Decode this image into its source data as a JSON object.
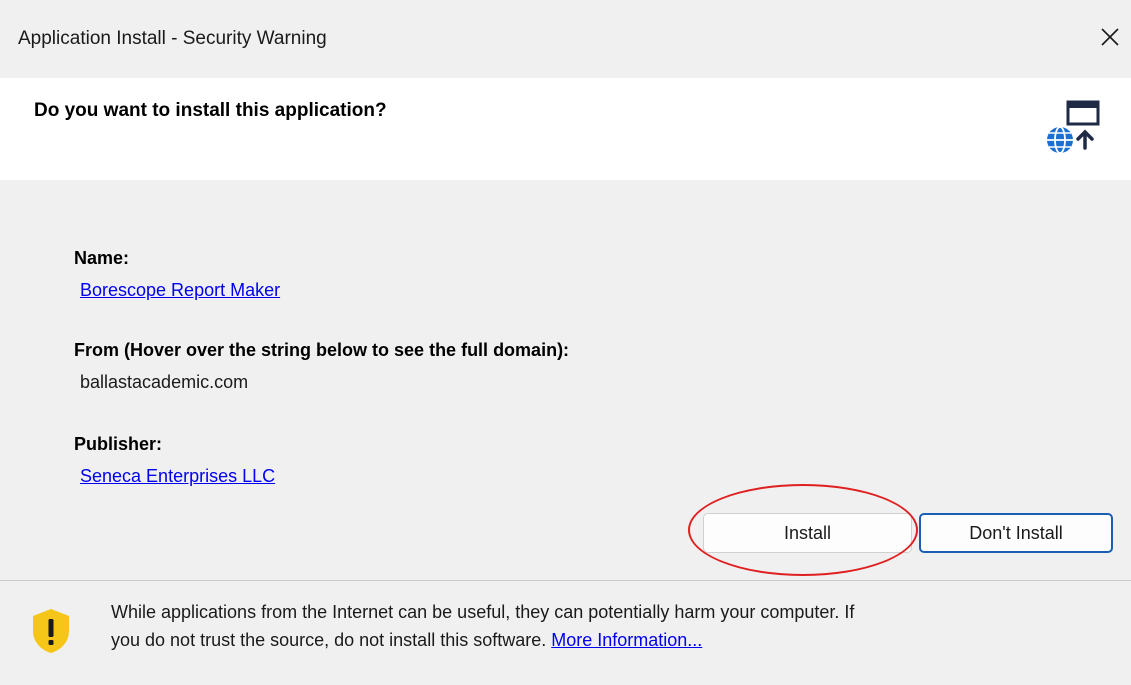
{
  "window": {
    "title": "Application Install - Security Warning",
    "close_glyph": "✕"
  },
  "header": {
    "question": "Do you want to install this application?",
    "icon": "globe-download-icon"
  },
  "details": {
    "name_label": "Name:",
    "name_value": "Borescope Report Maker",
    "from_label": "From (Hover over the string below to see the full domain):",
    "from_value": "ballastacademic.com",
    "publisher_label": "Publisher:",
    "publisher_value": "Seneca Enterprises LLC"
  },
  "buttons": {
    "install_label": "Install",
    "dont_install_label": "Don't Install"
  },
  "footer": {
    "icon": "shield-warning-icon",
    "warning_line1": "While applications from the Internet can be useful, they can potentially harm your computer. If",
    "warning_line2": "you do not trust the source, do not install this software.",
    "more_info_link": "More Information..."
  },
  "colors": {
    "link": "#0000ee",
    "shield": "#f5c518",
    "highlight": "#e02020",
    "icon_blue": "#1a6fd1"
  }
}
